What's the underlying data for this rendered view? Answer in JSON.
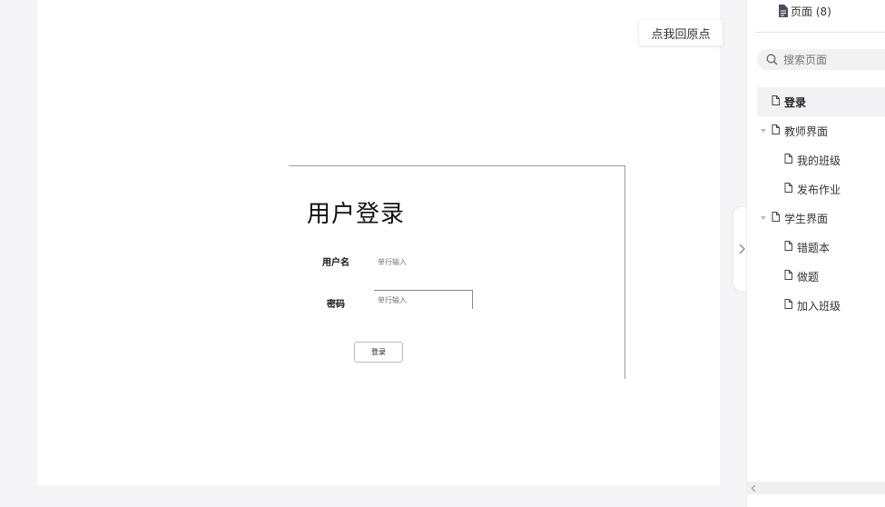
{
  "canvas": {
    "return_origin_label": "点我回原点"
  },
  "prototype": {
    "title": "用户登录",
    "username_label": "用户名",
    "username_placeholder": "单行输入",
    "password_label": "密码",
    "password_placeholder": "单行输入",
    "login_button_label": "登录"
  },
  "sidebar": {
    "pages_header": "页面 (8)",
    "search_placeholder": "搜索页面",
    "tree": [
      {
        "label": "登录",
        "level": 0,
        "selected": true,
        "expandable": false
      },
      {
        "label": "教师界面",
        "level": 0,
        "selected": false,
        "expandable": true
      },
      {
        "label": "我的班级",
        "level": 1,
        "selected": false,
        "expandable": false
      },
      {
        "label": "发布作业",
        "level": 1,
        "selected": false,
        "expandable": false
      },
      {
        "label": "学生界面",
        "level": 0,
        "selected": false,
        "expandable": true
      },
      {
        "label": "错题本",
        "level": 1,
        "selected": false,
        "expandable": false
      },
      {
        "label": "做题",
        "level": 1,
        "selected": false,
        "expandable": false
      },
      {
        "label": "加入班级",
        "level": 1,
        "selected": false,
        "expandable": false
      }
    ]
  },
  "icons": {
    "pages": "document-filled-icon",
    "search": "search-icon",
    "page": "document-outline-icon",
    "expand": "caret-down-icon",
    "collapse_panel": "chevron-right-icon",
    "scroll_left": "chevron-left-icon"
  },
  "colors": {
    "canvas_bg": "#f5f5f7",
    "selected_bg": "#f2f2f4",
    "frame_border": "#9a9a9a"
  }
}
